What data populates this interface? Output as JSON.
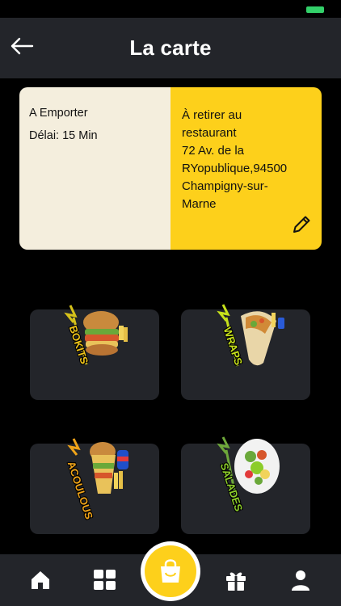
{
  "header": {
    "title": "La carte"
  },
  "order_info": {
    "mode": "A Emporter",
    "delay": "Délai: 15 Min",
    "pickup_lines": [
      "À retirer au",
      "restaurant",
      "72 Av. de la",
      "RYopublique,94500",
      "Champigny-sur-",
      "Marne"
    ]
  },
  "categories": [
    {
      "label": "BOKITS",
      "label_color": "#f0c419"
    },
    {
      "label": "WRAPS",
      "label_color": "#c7e21b"
    },
    {
      "label": "ACOULOUS",
      "label_color": "#f0a419"
    },
    {
      "label": "SALADES",
      "label_color": "#8ccd2a"
    }
  ],
  "colors": {
    "accent": "#fdd01b",
    "card_left": "#f4eedd",
    "surface": "#23252a",
    "battery": "#33d06a"
  },
  "nav": {
    "items": [
      "home-icon",
      "grid-icon",
      "shopping-bag-icon",
      "gift-icon",
      "user-icon"
    ]
  }
}
